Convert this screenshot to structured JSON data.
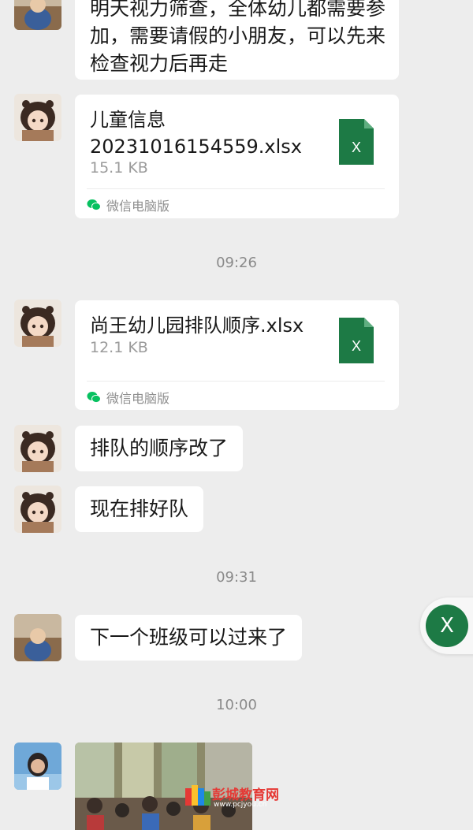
{
  "messages": {
    "m1": {
      "lines": [
        "明天视力筛查，全体幼儿都需要参",
        "加，需要请假的小朋友，可以先来",
        "检查视力后再走"
      ]
    },
    "m2": {
      "file_name_line1": "儿童信息",
      "file_name_line2": "20231016154559.xlsx",
      "file_size": "15.1 KB",
      "source": "微信电脑版",
      "file_icon_letter": "X"
    },
    "time1": "09:26",
    "m3": {
      "file_name": "尚王幼儿园排队顺序.xlsx",
      "file_size": "12.1 KB",
      "source": "微信电脑版",
      "file_icon_letter": "X"
    },
    "m4": {
      "text": "排队的顺序改了"
    },
    "m5": {
      "text": "现在排好队"
    },
    "time2": "09:31",
    "m6": {
      "text": "下一个班级可以过来了"
    },
    "time3": "10:00"
  },
  "floating_button": {
    "icon": "excel-icon",
    "letter": "X"
  },
  "watermark": {
    "title": "彭城教育网",
    "url": "www.pcjyou.cn"
  },
  "colors": {
    "background": "#ededed",
    "bubble": "#ffffff",
    "excel_green": "#1d7a45",
    "wechat_green": "#07c160",
    "timestamp": "#8a8a8a"
  }
}
